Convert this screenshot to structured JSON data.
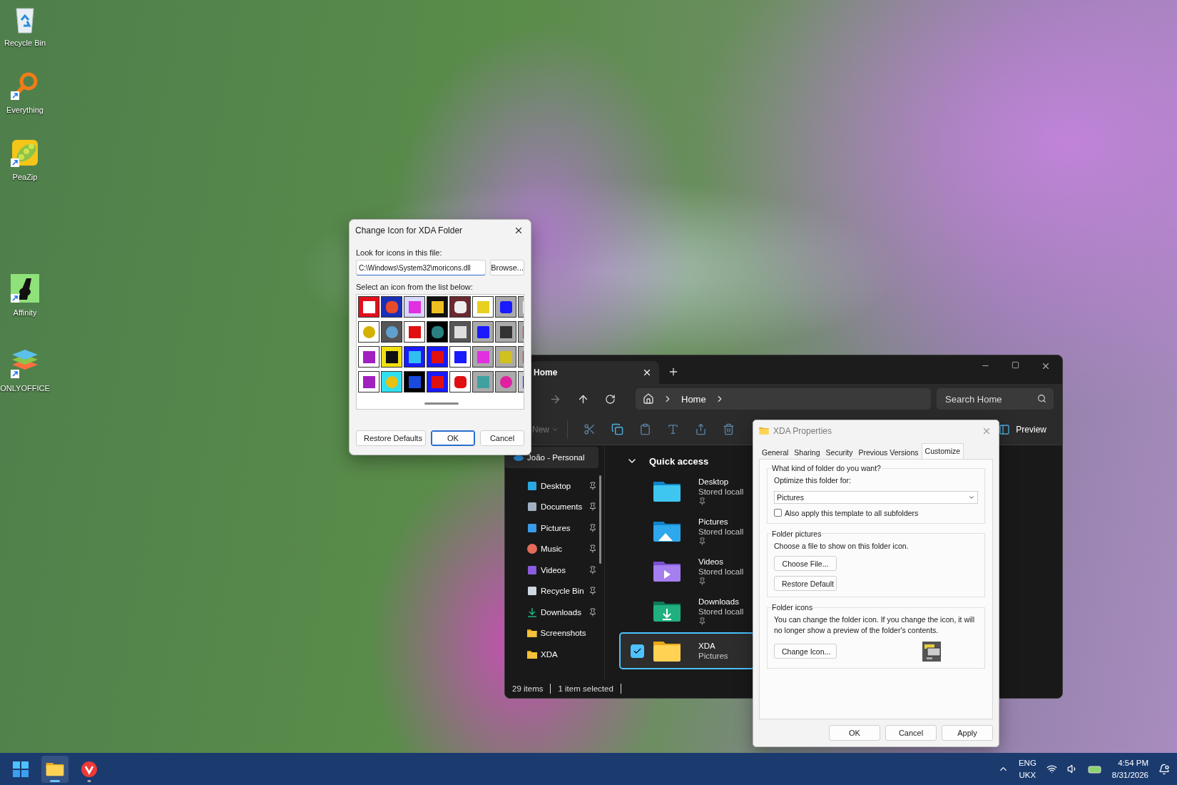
{
  "desktop_icons": [
    {
      "label": "Recycle Bin",
      "kind": "recycle",
      "shortcut": false
    },
    {
      "label": "Everything",
      "kind": "everything",
      "shortcut": true
    },
    {
      "label": "PeaZip",
      "kind": "peazip",
      "shortcut": true
    },
    {
      "label": "Affinity",
      "kind": "affinity",
      "shortcut": true
    },
    {
      "label": "ONLYOFFICE",
      "kind": "onlyoffice",
      "shortcut": true
    }
  ],
  "change_icon_dialog": {
    "title": "Change Icon for XDA Folder",
    "file_label": "Look for icons in this file:",
    "file_value": "C:\\Windows\\System32\\moricons.dll",
    "browse": "Browse...",
    "list_label": "Select an icon from the list below:",
    "buttons": [
      {
        "label": "Restore Defaults",
        "default": false
      },
      {
        "label": "OK",
        "default": true
      },
      {
        "label": "Cancel",
        "default": false
      }
    ]
  },
  "explorer": {
    "tabs": [
      {
        "label": "Home",
        "selected": true
      }
    ],
    "breadcrumb": [
      "Home"
    ],
    "search": {
      "placeholder": "Search Home"
    },
    "new_label": "New",
    "preview_label": "Preview",
    "sidebar": {
      "account": "João - Personal",
      "items": [
        {
          "label": "Desktop",
          "kind": "desktop",
          "pinned": true
        },
        {
          "label": "Documents",
          "kind": "documents",
          "pinned": true
        },
        {
          "label": "Pictures",
          "kind": "pictures",
          "pinned": true
        },
        {
          "label": "Music",
          "kind": "music",
          "pinned": true
        },
        {
          "label": "Videos",
          "kind": "videos",
          "pinned": true
        },
        {
          "label": "Recycle Bin",
          "kind": "recycle",
          "pinned": true
        },
        {
          "label": "Downloads",
          "kind": "downloads",
          "pinned": true
        },
        {
          "label": "Screenshots",
          "kind": "folder",
          "pinned": false
        },
        {
          "label": "XDA",
          "kind": "folder",
          "pinned": false
        }
      ]
    },
    "section": "Quick access",
    "folders": [
      {
        "name": "Desktop",
        "detail": "Stored locall",
        "kind": "desktop",
        "pinned": true,
        "selected": false
      },
      {
        "name": "Pictures",
        "detail": "Stored locall",
        "kind": "pictures",
        "pinned": true,
        "selected": false
      },
      {
        "name": "Videos",
        "detail": "Stored locall",
        "kind": "videos",
        "pinned": true,
        "selected": false
      },
      {
        "name": "Downloads",
        "detail": "Stored locall",
        "kind": "downloads",
        "pinned": true,
        "selected": false
      },
      {
        "name": "XDA",
        "detail": "Pictures",
        "kind": "folder",
        "pinned": false,
        "selected": true
      }
    ],
    "status": [
      "29 items",
      "1 item selected"
    ]
  },
  "properties_dialog": {
    "title": "XDA Properties",
    "tabs": [
      {
        "label": "General",
        "selected": false
      },
      {
        "label": "Sharing",
        "selected": false
      },
      {
        "label": "Security",
        "selected": false
      },
      {
        "label": "Previous Versions",
        "selected": false
      },
      {
        "label": "Customize",
        "selected": true
      }
    ],
    "folder_type": {
      "legend": "What kind of folder do you want?",
      "optimize_label": "Optimize this folder for:",
      "optimize_value": "Pictures",
      "subfolders": {
        "label": "Also apply this template to all subfolders",
        "checked": false
      }
    },
    "folder_pictures": {
      "legend": "Folder pictures",
      "text": "Choose a file to show on this folder icon.",
      "buttons": [
        "Choose File...",
        "Restore Default"
      ]
    },
    "folder_icons": {
      "legend": "Folder icons",
      "text": "You can change the folder icon. If you change the icon, it will no longer show a preview of the folder's contents.",
      "button": "Change Icon..."
    },
    "buttons": [
      "OK",
      "Cancel",
      "Apply"
    ]
  },
  "taskbar": {
    "apps": [
      {
        "kind": "start",
        "active": false
      },
      {
        "kind": "explorer",
        "active": true
      },
      {
        "kind": "vivaldi",
        "active": false
      }
    ],
    "language": [
      "ENG",
      "UKX"
    ],
    "time": "4:54 PM",
    "date": "8/31/2026"
  }
}
